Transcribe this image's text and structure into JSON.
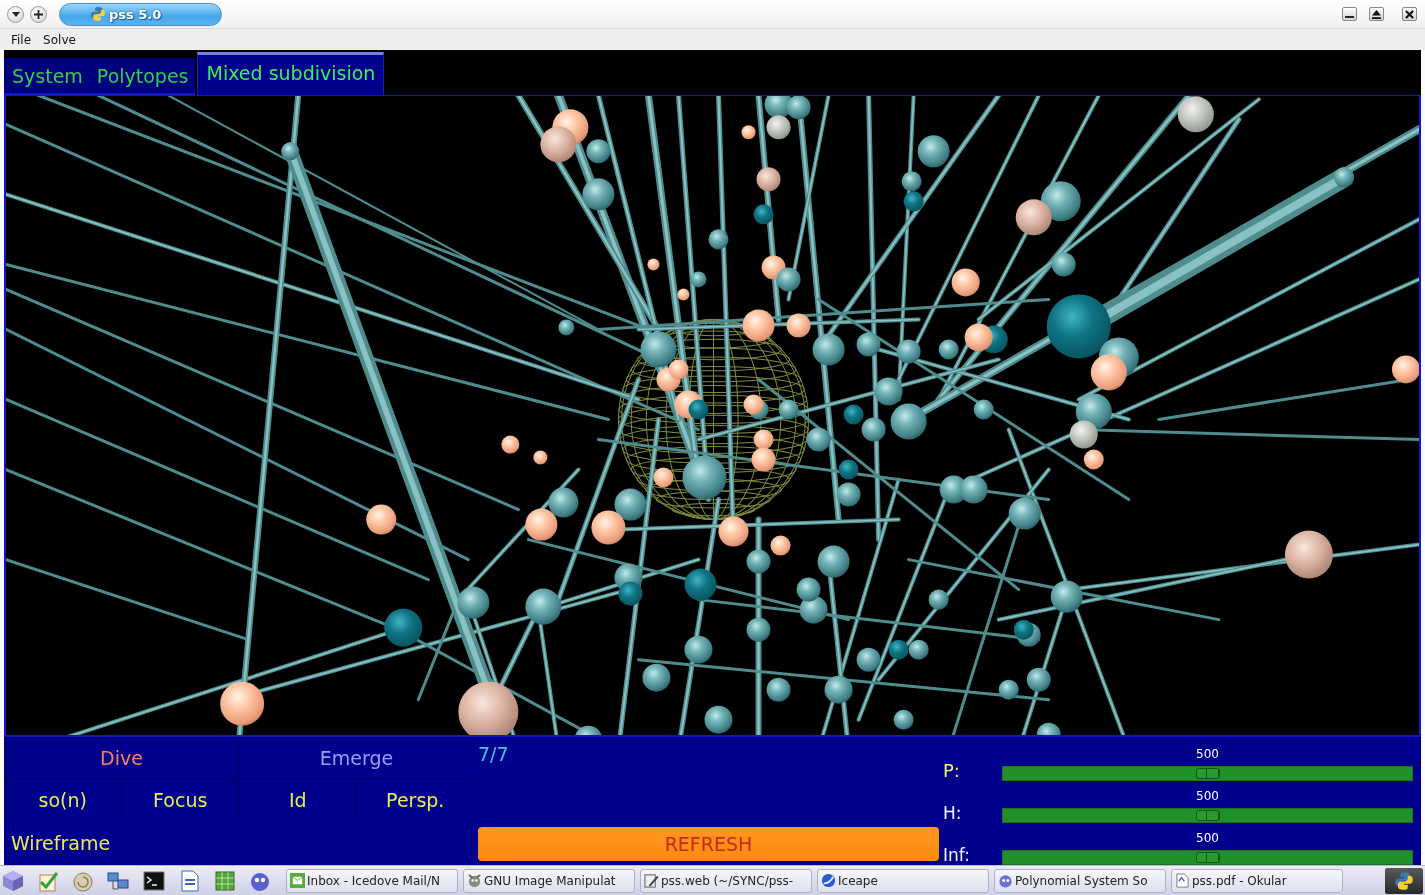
{
  "window": {
    "title": "pss 5.0"
  },
  "menu_bar": [
    "File",
    "Solve"
  ],
  "tabs": [
    {
      "label": "System",
      "selected": false
    },
    {
      "label": "Polytopes",
      "selected": false
    },
    {
      "label": "Mixed subdivision",
      "selected": true
    }
  ],
  "controls": {
    "navigation": [
      {
        "label": "Dive",
        "disabled": false
      },
      {
        "label": "Emerge",
        "disabled": true
      }
    ],
    "counter": "7/7",
    "view_buttons": [
      "so(n)",
      "Focus",
      "Id",
      "Persp."
    ],
    "wireframe": "Wireframe",
    "refresh": "REFRESH",
    "sliders": [
      {
        "label": "P:",
        "reading": "500",
        "level": 0.5,
        "selected": true
      },
      {
        "label": "H:",
        "reading": "500",
        "level": 0.5,
        "selected": false
      },
      {
        "label": "Inf:",
        "reading": "500",
        "level": 0.5,
        "selected": false
      }
    ]
  },
  "taskbar": {
    "tasks": [
      "Inbox - Icedove Mail/N",
      "GNU Image Manipulat",
      "pss.web (~/SYNC/pss-",
      "Iceape",
      "Polynomial System So",
      "pss.pdf - Okular"
    ]
  }
}
